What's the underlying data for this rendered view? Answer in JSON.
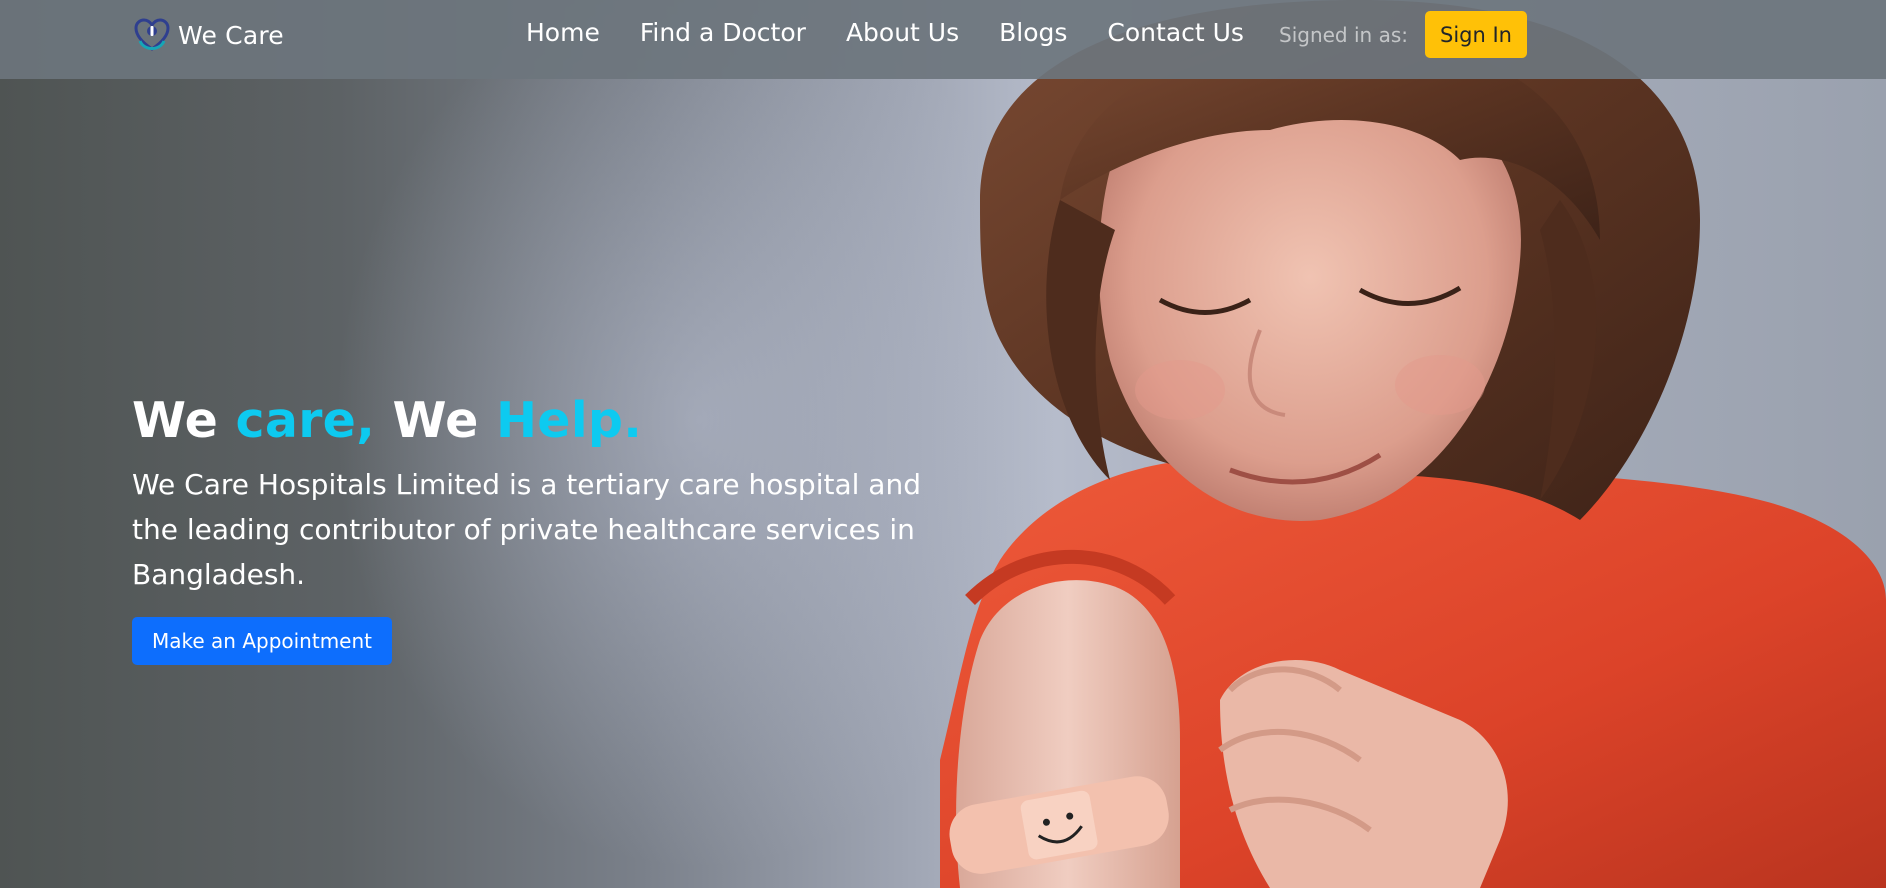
{
  "brand": {
    "name": "We Care",
    "logo_icon": "heart-stethoscope-logo-icon"
  },
  "nav": {
    "items": [
      {
        "label": "Home"
      },
      {
        "label": "Find a Doctor"
      },
      {
        "label": "About Us"
      },
      {
        "label": "Blogs"
      },
      {
        "label": "Contact Us"
      }
    ],
    "signed_in_label": "Signed in as:",
    "signin_label": "Sign In"
  },
  "hero": {
    "title_parts": [
      "We ",
      "care,",
      " We ",
      "Help."
    ],
    "description": "We Care Hospitals Limited is a tertiary care hospital and the leading contributor of private healthcare services in Bangladesh.",
    "cta_label": "Make an Appointment",
    "image_subject": "smiling girl with a smiley-face bandage on her arm"
  },
  "colors": {
    "navbar": "#6c757d",
    "signin_button": "#ffc107",
    "cta_button": "#0d6efd",
    "title_accent": "#0dcaf0",
    "shirt": "#e0442b"
  }
}
